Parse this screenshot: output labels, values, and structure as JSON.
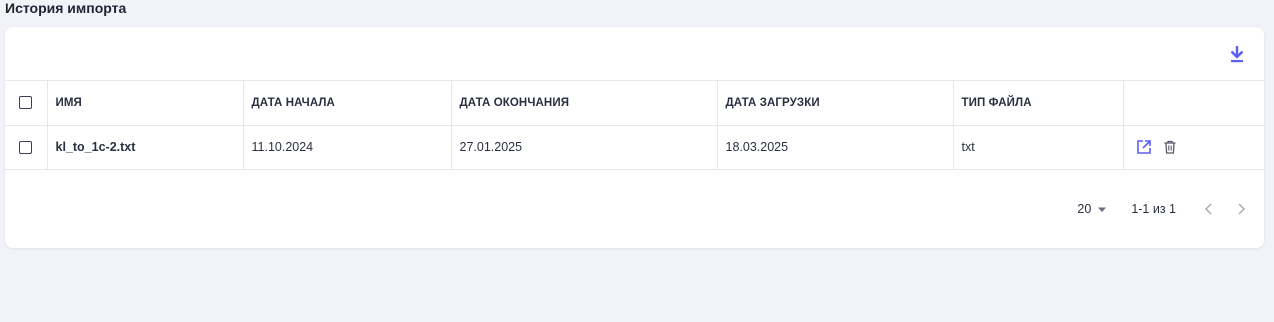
{
  "page": {
    "title": "История импорта"
  },
  "toolbar": {
    "download_icon": "download-icon",
    "accent_color": "#5b5ff2"
  },
  "table": {
    "headers": {
      "select_all": "",
      "name": "ИМЯ",
      "start_date": "ДАТА НАЧАЛА",
      "end_date": "ДАТА ОКОНЧАНИЯ",
      "upload_date": "ДАТА ЗАГРУЗКИ",
      "file_type": "ТИП ФАЙЛА",
      "actions": ""
    },
    "rows": [
      {
        "name": "kl_to_1c-2.txt",
        "start_date": "11.10.2024",
        "end_date": "27.01.2025",
        "upload_date": "18.03.2025",
        "file_type": "txt",
        "actions": [
          "open-external-icon",
          "trash-icon"
        ]
      }
    ]
  },
  "pagination": {
    "page_size": "20",
    "range": "1-1 из 1",
    "prev_icon": "chevron-left-icon",
    "next_icon": "chevron-right-icon"
  }
}
